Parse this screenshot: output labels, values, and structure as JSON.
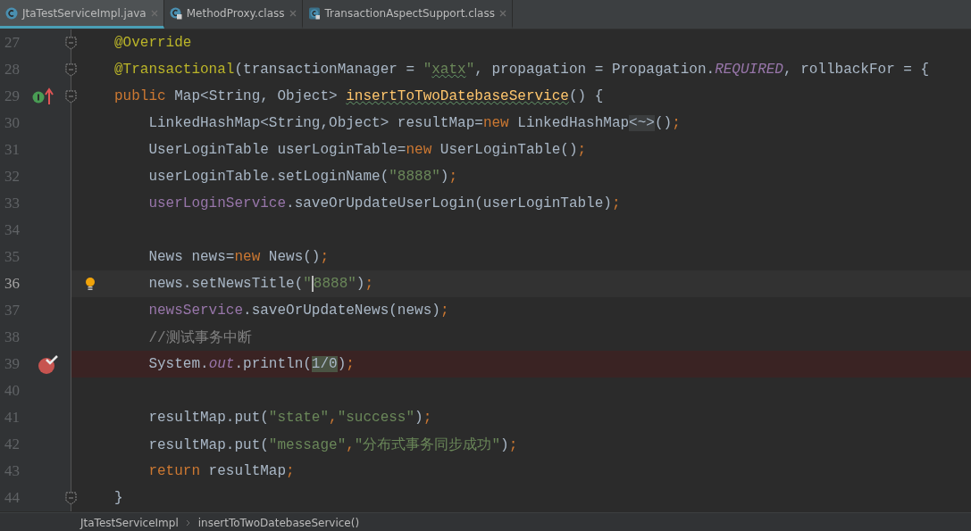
{
  "tabs": [
    {
      "label": "JtaTestServiceImpl.java",
      "kind": "class",
      "selected": true
    },
    {
      "label": "MethodProxy.class",
      "kind": "class-locked",
      "selected": false
    },
    {
      "label": "TransactionAspectSupport.class",
      "kind": "class-file-locked",
      "selected": false
    }
  ],
  "editor": {
    "lines": [
      {
        "number": "27",
        "fold": true,
        "tokens": [
          {
            "t": "@Override",
            "kind": "ann"
          }
        ]
      },
      {
        "number": "28",
        "fold": true,
        "tokens": [
          {
            "t": "@Transactional",
            "kind": "ann"
          },
          {
            "t": "(transactionManager = ",
            "kind": "plain"
          },
          {
            "t": "\"",
            "kind": "str"
          },
          {
            "t": "xatx",
            "kind": "str",
            "typo": true
          },
          {
            "t": "\"",
            "kind": "str"
          },
          {
            "t": ", propagation = Propagation.",
            "kind": "plain"
          },
          {
            "t": "REQUIRED",
            "kind": "static"
          },
          {
            "t": ", rollbackFor = {",
            "kind": "plain"
          }
        ]
      },
      {
        "number": "29",
        "fold": true,
        "kind": "implements",
        "tokens": [
          {
            "t": "public ",
            "kind": "kw"
          },
          {
            "t": "Map<String, Object> ",
            "kind": "plain"
          },
          {
            "t": "insertToTwoDatebaseService",
            "kind": "method",
            "typo": true
          },
          {
            "t": "() {",
            "kind": "plain"
          }
        ]
      },
      {
        "number": "30",
        "tokens": [
          {
            "t": "    LinkedHashMap<String,Object> resultMap=",
            "kind": "plain"
          },
          {
            "t": "new",
            "kind": "kw"
          },
          {
            "t": " LinkedHashMap",
            "kind": "plain"
          },
          {
            "t": "<~>",
            "kind": "fold"
          },
          {
            "t": "()",
            "kind": "plain"
          },
          {
            "t": ";",
            "kind": "kw"
          }
        ]
      },
      {
        "number": "31",
        "tokens": [
          {
            "t": "    UserLoginTable userLoginTable=",
            "kind": "plain"
          },
          {
            "t": "new",
            "kind": "kw"
          },
          {
            "t": " UserLoginTable()",
            "kind": "plain"
          },
          {
            "t": ";",
            "kind": "kw"
          }
        ]
      },
      {
        "number": "32",
        "tokens": [
          {
            "t": "    userLoginTable.setLoginName(",
            "kind": "plain"
          },
          {
            "t": "\"8888\"",
            "kind": "str"
          },
          {
            "t": ")",
            "kind": "plain"
          },
          {
            "t": ";",
            "kind": "kw"
          }
        ]
      },
      {
        "number": "33",
        "tokens": [
          {
            "t": "    userLoginService",
            "kind": "field"
          },
          {
            "t": ".saveOrUpdateUserLogin(userLoginTable)",
            "kind": "plain"
          },
          {
            "t": ";",
            "kind": "kw"
          }
        ]
      },
      {
        "number": "34"
      },
      {
        "number": "35",
        "tokens": [
          {
            "t": "    News news=",
            "kind": "plain"
          },
          {
            "t": "new",
            "kind": "kw"
          },
          {
            "t": " News()",
            "kind": "plain"
          },
          {
            "t": ";",
            "kind": "kw"
          }
        ]
      },
      {
        "number": "36",
        "current": true,
        "bulb": true,
        "tokens": [
          {
            "t": "    news.setNewsTitle(",
            "kind": "plain"
          },
          {
            "t": "\"",
            "kind": "str"
          },
          {
            "t": "8888\"",
            "kind": "str",
            "caret": true
          },
          {
            "t": ")",
            "kind": "plain"
          },
          {
            "t": ";",
            "kind": "kw"
          }
        ]
      },
      {
        "number": "37",
        "tokens": [
          {
            "t": "    newsService",
            "kind": "field"
          },
          {
            "t": ".saveOrUpdateNews(news)",
            "kind": "plain"
          },
          {
            "t": ";",
            "kind": "kw"
          }
        ]
      },
      {
        "number": "38",
        "tokens": [
          {
            "t": "    //测试事务中断",
            "kind": "comment"
          }
        ]
      },
      {
        "number": "39",
        "kind": "breakpoint",
        "tokens": [
          {
            "t": "    System.",
            "kind": "plain"
          },
          {
            "t": "out",
            "kind": "static"
          },
          {
            "t": ".println(",
            "kind": "plain"
          },
          {
            "t": "1/0",
            "kind": "match"
          },
          {
            "t": ")",
            "kind": "plain"
          },
          {
            "t": ";",
            "kind": "kw"
          }
        ]
      },
      {
        "number": "40"
      },
      {
        "number": "41",
        "tokens": [
          {
            "t": "    resultMap.put(",
            "kind": "plain"
          },
          {
            "t": "\"state\"",
            "kind": "str"
          },
          {
            "t": ",",
            "kind": "kw"
          },
          {
            "t": "\"success\"",
            "kind": "str"
          },
          {
            "t": ")",
            "kind": "plain"
          },
          {
            "t": ";",
            "kind": "kw"
          }
        ]
      },
      {
        "number": "42",
        "tokens": [
          {
            "t": "    resultMap.put(",
            "kind": "plain"
          },
          {
            "t": "\"message\"",
            "kind": "str"
          },
          {
            "t": ",",
            "kind": "kw"
          },
          {
            "t": "\"分布式事务同步成功\"",
            "kind": "str"
          },
          {
            "t": ")",
            "kind": "plain"
          },
          {
            "t": ";",
            "kind": "kw"
          }
        ]
      },
      {
        "number": "43",
        "tokens": [
          {
            "t": "    return",
            "kind": "kw"
          },
          {
            "t": " resultMap",
            "kind": "plain"
          },
          {
            "t": ";",
            "kind": "kw"
          }
        ]
      },
      {
        "number": "44",
        "fold": true,
        "tokens": [
          {
            "t": "}",
            "kind": "plain"
          }
        ]
      }
    ]
  },
  "breadcrumbs": [
    "JtaTestServiceImpl",
    "insertToTwoDatebaseService()"
  ]
}
